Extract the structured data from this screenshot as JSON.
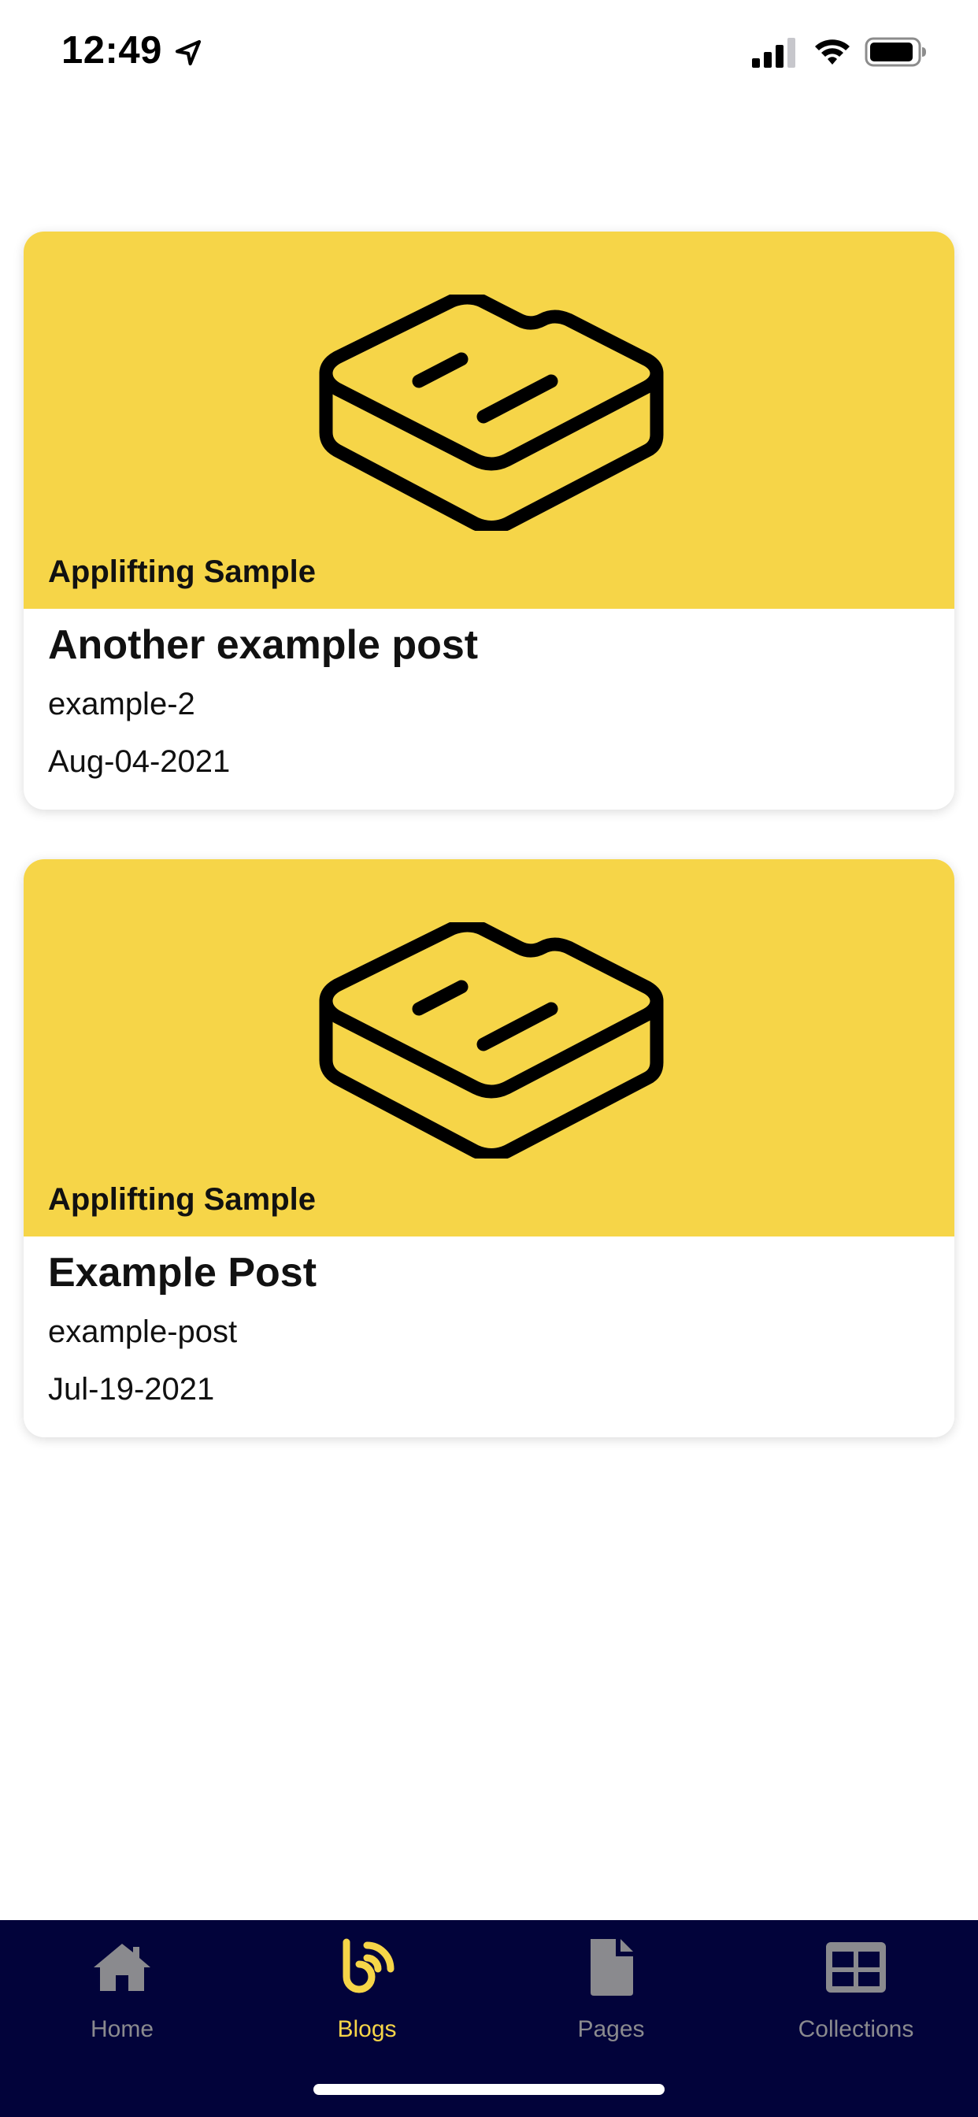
{
  "status_bar": {
    "time": "12:49"
  },
  "posts": [
    {
      "source": "Applifting Sample",
      "title": "Another example post",
      "slug": "example-2",
      "date": "Aug-04-2021"
    },
    {
      "source": "Applifting Sample",
      "title": "Example Post",
      "slug": "example-post",
      "date": "Jul-19-2021"
    }
  ],
  "tabs": [
    {
      "label": "Home",
      "icon": "home-icon",
      "active": false
    },
    {
      "label": "Blogs",
      "icon": "blog-icon",
      "active": true
    },
    {
      "label": "Pages",
      "icon": "page-icon",
      "active": false
    },
    {
      "label": "Collections",
      "icon": "collections-icon",
      "active": false
    }
  ],
  "colors": {
    "accent": "#f6d548",
    "tab_bar_background": "#02033a",
    "tab_inactive": "#8a8a8e"
  }
}
